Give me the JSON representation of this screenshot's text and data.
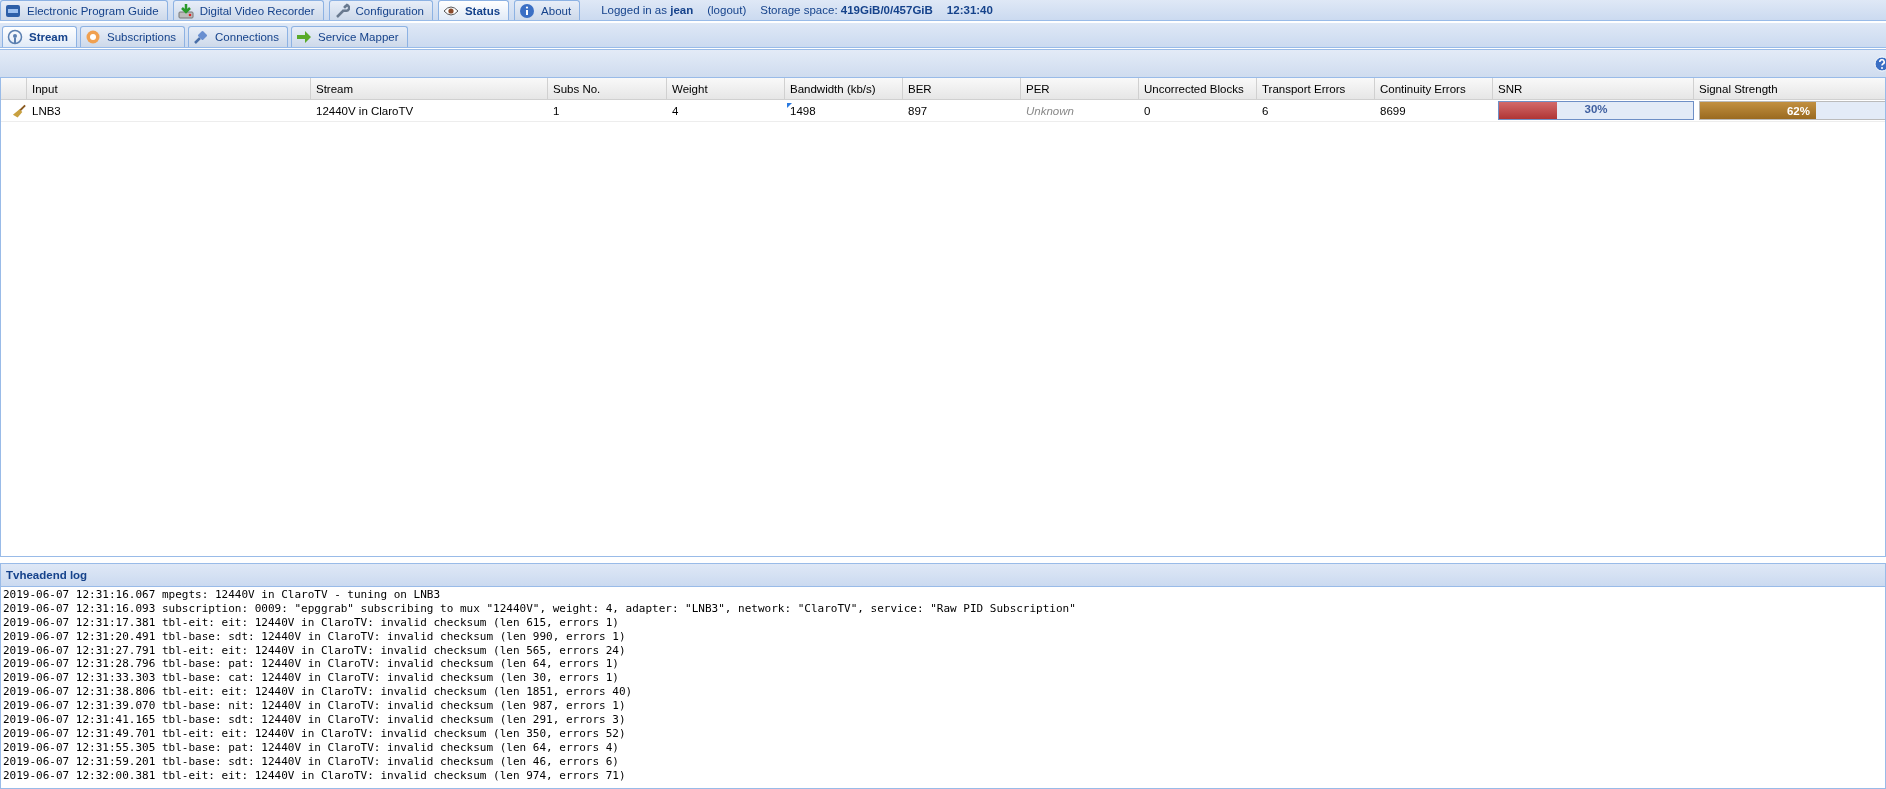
{
  "top_tabs": [
    {
      "label": "Electronic Program Guide",
      "kind": "epg",
      "selected": false
    },
    {
      "label": "Digital Video Recorder",
      "kind": "dvr",
      "selected": false
    },
    {
      "label": "Configuration",
      "kind": "wrench",
      "selected": false
    },
    {
      "label": "Status",
      "kind": "eye",
      "selected": true
    },
    {
      "label": "About",
      "kind": "info",
      "selected": false
    }
  ],
  "session": {
    "logged_in_label": "Logged in as",
    "user": "jean",
    "logout": "(logout)",
    "storage_label": "Storage space:",
    "storage": "419GiB/0/457GiB",
    "time": "12:31:40"
  },
  "sub_tabs": [
    {
      "label": "Stream",
      "kind": "antenna",
      "selected": true
    },
    {
      "label": "Subscriptions",
      "kind": "subs",
      "selected": false
    },
    {
      "label": "Connections",
      "kind": "plug",
      "selected": false
    },
    {
      "label": "Service Mapper",
      "kind": "arrow",
      "selected": false
    }
  ],
  "table": {
    "columns": [
      "Input",
      "Stream",
      "Subs No.",
      "Weight",
      "Bandwidth (kb/s)",
      "BER",
      "PER",
      "Uncorrected Blocks",
      "Transport Errors",
      "Continuity Errors",
      "SNR",
      "Signal Strength"
    ],
    "rows": [
      {
        "input": "LNB3",
        "stream": "12440V in ClaroTV",
        "subs": "1",
        "weight": "4",
        "bandwidth": "1498",
        "bandwidth_changed": true,
        "ber": "897",
        "per": "Unknown",
        "per_unknown": true,
        "uncorrected": "0",
        "transport": "6",
        "continuity": "8699",
        "snr": {
          "level": 0.3,
          "reading": "30%"
        },
        "signal": {
          "level": 0.62,
          "reading": "62%"
        }
      }
    ]
  },
  "log": {
    "title": "Tvheadend log",
    "lines": [
      "2019-06-07 12:31:16.067 mpegts: 12440V in ClaroTV - tuning on LNB3",
      "2019-06-07 12:31:16.093 subscription: 0009: \"epggrab\" subscribing to mux \"12440V\", weight: 4, adapter: \"LNB3\", network: \"ClaroTV\", service: \"Raw PID Subscription\"",
      "2019-06-07 12:31:17.381 tbl-eit: eit: 12440V in ClaroTV: invalid checksum (len 615, errors 1)",
      "2019-06-07 12:31:20.491 tbl-base: sdt: 12440V in ClaroTV: invalid checksum (len 990, errors 1)",
      "2019-06-07 12:31:27.791 tbl-eit: eit: 12440V in ClaroTV: invalid checksum (len 565, errors 24)",
      "2019-06-07 12:31:28.796 tbl-base: pat: 12440V in ClaroTV: invalid checksum (len 64, errors 1)",
      "2019-06-07 12:31:33.303 tbl-base: cat: 12440V in ClaroTV: invalid checksum (len 30, errors 1)",
      "2019-06-07 12:31:38.806 tbl-eit: eit: 12440V in ClaroTV: invalid checksum (len 1851, errors 40)",
      "2019-06-07 12:31:39.070 tbl-base: nit: 12440V in ClaroTV: invalid checksum (len 987, errors 1)",
      "2019-06-07 12:31:41.165 tbl-base: sdt: 12440V in ClaroTV: invalid checksum (len 291, errors 3)",
      "2019-06-07 12:31:49.701 tbl-eit: eit: 12440V in ClaroTV: invalid checksum (len 350, errors 52)",
      "2019-06-07 12:31:55.305 tbl-base: pat: 12440V in ClaroTV: invalid checksum (len 64, errors 4)",
      "2019-06-07 12:31:59.201 tbl-base: sdt: 12440V in ClaroTV: invalid checksum (len 46, errors 6)",
      "2019-06-07 12:32:00.381 tbl-eit: eit: 12440V in ClaroTV: invalid checksum (len 974, errors 71)"
    ]
  }
}
